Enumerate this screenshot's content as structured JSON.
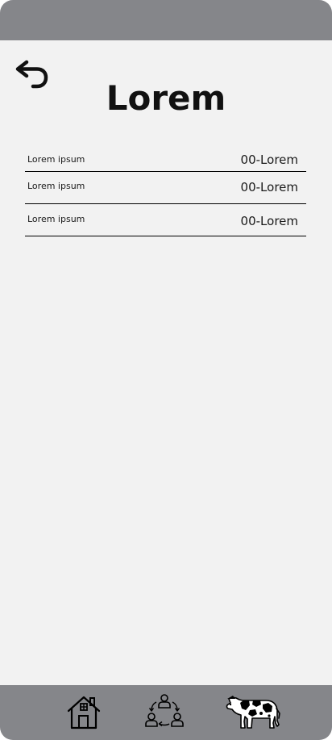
{
  "header": {
    "title": "Lorem"
  },
  "list": {
    "items": [
      {
        "label": "Lorem ipsum",
        "value": "00-Lorem"
      },
      {
        "label": "Lorem ipsum",
        "value": "00-Lorem"
      },
      {
        "label": "Lorem ipsum",
        "value": "00-Lorem"
      }
    ]
  },
  "icons": {
    "back": "undo-arrow-icon",
    "home": "home-icon",
    "community": "people-cycle-icon",
    "cow": "cow-icon"
  },
  "colors": {
    "bars": "#85868a",
    "background": "#f2f2f2",
    "text": "#111111"
  }
}
